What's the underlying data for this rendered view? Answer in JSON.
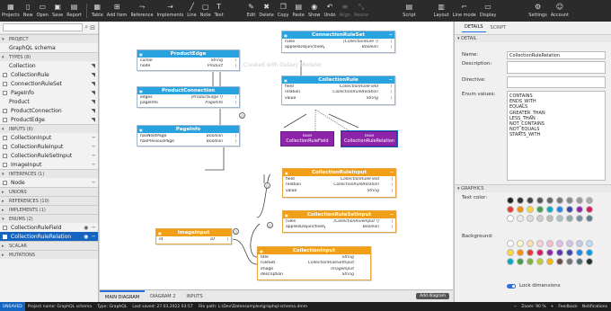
{
  "toolbar": {
    "items": [
      "Projects",
      "New",
      "Open",
      "Save",
      "Report",
      "Table",
      "Add Item",
      "Reference",
      "Implements",
      "Line",
      "Note",
      "Text",
      "Edit",
      "Delete",
      "Copy",
      "Paste",
      "Show",
      "Undo",
      "Align",
      "Resize",
      "Script",
      "Layout",
      "Line mode",
      "Display",
      "Settings",
      "Account"
    ]
  },
  "left": {
    "project_header": "PROJECT",
    "project_name": "GraphQL schema",
    "types_header": "TYPES (8)",
    "types": [
      "Collection",
      "CollectionRule",
      "ConnectionRuleSet",
      "PageInfo",
      "Product",
      "ProductConnection",
      "ProductEdge"
    ],
    "inputs_header": "INPUTS (6)",
    "inputs": [
      "CollectionInput",
      "CollectionRuleInput",
      "CollectionRuleSetInput",
      "ImageInput"
    ],
    "interfaces_header": "INTERFACES (1)",
    "interfaces": [
      "Node"
    ],
    "unions_header": "UNIONS",
    "references_header": "REFERENCES (10)",
    "implements_header": "IMPLEMENTS (1)",
    "enums_header": "ENUMS (2)",
    "enums": [
      "CollectionRuleField",
      "CollectionRuleRelation"
    ],
    "scalar_header": "SCALAR",
    "mutations_header": "MUTATIONS"
  },
  "canvas": {
    "watermark": "Created with Galaxy Modeler",
    "nodes": {
      "product_edge": {
        "title": "ProductEdge",
        "rows": [
          [
            "cursor",
            "String",
            "!"
          ],
          [
            "node",
            "Product",
            "!"
          ]
        ]
      },
      "product_connection": {
        "title": "ProductConnection",
        "rows": [
          [
            "edges",
            "[ProductEdge !]",
            "!"
          ],
          [
            "pageInfo",
            "PageInfo",
            "!"
          ]
        ]
      },
      "page_info": {
        "title": "PageInfo",
        "rows": [
          [
            "hasNextPage",
            "Boolean",
            "!"
          ],
          [
            "hasPreviousPage",
            "Boolean",
            "!"
          ]
        ]
      },
      "connection_rule_set": {
        "title": "ConnectionRuleSet",
        "rows": [
          [
            "rules",
            "[CollectionRule !]",
            "!"
          ],
          [
            "appliesDisjunctively",
            "Boolean",
            "!"
          ]
        ]
      },
      "collection_rule": {
        "title": "CollectionRule",
        "rows": [
          [
            "field",
            "CollectionRuleField",
            "!"
          ],
          [
            "relation",
            "CollectionRuleRelation",
            "!"
          ],
          [
            "value",
            "String",
            "!"
          ]
        ]
      },
      "collection_rule_input": {
        "title": "CollectionRuleInput",
        "rows": [
          [
            "field",
            "CollectionRuleField",
            "!"
          ],
          [
            "relation",
            "CollectionRuleRelation",
            "!"
          ],
          [
            "value",
            "String",
            "!"
          ]
        ]
      },
      "collection_rule_set_input": {
        "title": "CollectionRuleSetInput",
        "rows": [
          [
            "rules",
            "[CollectionRuleInput !]",
            "!"
          ],
          [
            "appliesDisjunctively",
            "Boolean",
            "!"
          ]
        ]
      },
      "image_input": {
        "title": "ImageInput",
        "rows": [
          [
            "id",
            "ID",
            "!"
          ]
        ]
      },
      "collection_input": {
        "title": "CollectionInput",
        "rows": [
          [
            "title",
            "String",
            ""
          ],
          [
            "ruleSet",
            "CollectionRuleSetInput",
            ""
          ],
          [
            "image",
            "ImageInput",
            ""
          ],
          [
            "description",
            "String",
            ""
          ]
        ]
      }
    },
    "enum_tag": "ENUM",
    "enum_field": "CollectionRuleField",
    "enum_relation": "CollectionRuleRelation"
  },
  "diagram_tabs": [
    "MAIN DIAGRAM",
    "DIAGRAM 2",
    "INPUTS"
  ],
  "add_diagram": "Add diagram",
  "right": {
    "tabs": [
      "DETAILS",
      "SCRIPT"
    ],
    "detail_header": "DETAIL",
    "name_label": "Name:",
    "name_value": "CollectionRuleRelation",
    "description_label": "Description:",
    "directive_label": "Directive:",
    "enum_values_label": "Enum values:",
    "enum_values": [
      "CONTAINS",
      "ENDS_WITH",
      "EQUALS",
      "GREATER_THAN",
      "LESS_THAN",
      "NOT_CONTAINS",
      "NOT_EQUALS",
      "STARTS_WITH"
    ],
    "graphics_header": "GRAPHICS",
    "text_color_label": "Text color:",
    "background_label": "Background:",
    "lock_label": "Lock dimensions",
    "text_colors": [
      "#222222",
      "#333333",
      "#444444",
      "#555555",
      "#666666",
      "#777777",
      "#888888",
      "#999999",
      "#aaaaaa",
      "#e53935",
      "#fb8c00",
      "#fdd835",
      "#43a047",
      "#00acc1",
      "#1e88e5",
      "#3949ab",
      "#8e24aa",
      "#d81b60",
      "#ffffff",
      "#eeeeee",
      "#dddddd",
      "#cccccc",
      "#bbbbbb",
      "#b0bec5",
      "#90a4ae",
      "#78909c",
      "#607d8b"
    ],
    "bg_colors": [
      "#ffffff",
      "#fff9c4",
      "#ffe0b2",
      "#ffcdd2",
      "#f8bbd0",
      "#e1bee7",
      "#d1c4e9",
      "#c5cae9",
      "#bbdefb",
      "#fdd835",
      "#fb8c00",
      "#e53935",
      "#d81b60",
      "#8e24aa",
      "#5e35b1",
      "#3949ab",
      "#1e88e5",
      "#039be5",
      "#00acc1",
      "#43a047",
      "#7cb342",
      "#c0ca33",
      "#ffb300",
      "#6d4c41",
      "#757575",
      "#546e7a",
      "#263238"
    ]
  },
  "status": {
    "unsaved": "UNSAVED",
    "project": "Project name: GraphQL schema",
    "type": "Type: GraphQL",
    "saved": "Last saved: 27.03.2022 03:57",
    "path": "File path: L:\\Dev\\Datensamples\\graphql-schema.dmm",
    "zoom": "Zoom: 90 %",
    "feedback": "Feedback",
    "notifications": "Notifications"
  }
}
